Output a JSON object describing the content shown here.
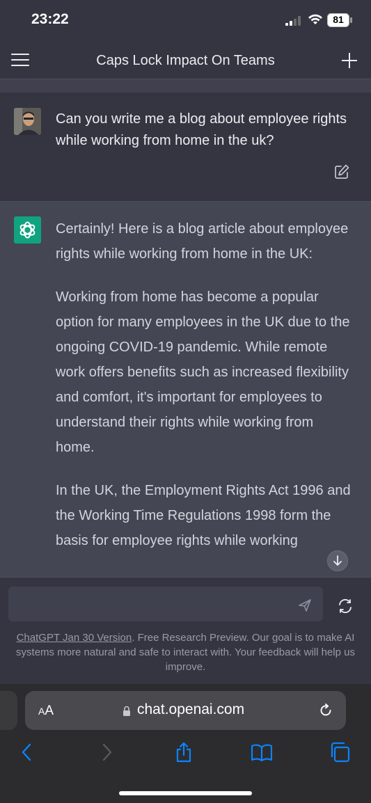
{
  "status": {
    "time": "23:22",
    "battery": "81"
  },
  "nav": {
    "title": "Caps Lock Impact On Teams",
    "menu_icon": "hamburger-icon",
    "new_icon": "plus-icon"
  },
  "user_message": {
    "text": "Can you write me a blog about employee rights while working from home in the uk?"
  },
  "assistant_message": {
    "paragraphs": [
      "Certainly! Here is a blog article about employee rights while working from home in the UK:",
      "Working from home has become a popular option for many employees in the UK due to the ongoing COVID-19 pandemic. While remote work offers benefits such as increased flexibility and comfort, it's important for employees to understand their rights while working from home.",
      "In the UK, the Employment Rights Act 1996 and the Working Time Regulations 1998 form the basis for employee rights while working"
    ]
  },
  "composer": {
    "placeholder": "",
    "value": ""
  },
  "disclaimer": {
    "link": "ChatGPT Jan 30 Version",
    "text": ". Free Research Preview. Our goal is to make AI systems more natural and safe to interact with. Your feedback will help us improve."
  },
  "browser": {
    "aa_label": "AA",
    "url": "chat.openai.com"
  },
  "colors": {
    "background": "#343541",
    "assistant_bg": "#444654",
    "accent": "#10a37f",
    "ios_blue": "#0a84ff"
  }
}
